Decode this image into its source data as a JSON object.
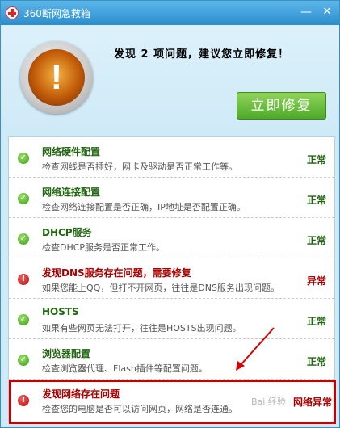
{
  "window": {
    "title": "360断网急救箱",
    "minimize_glyph": "—",
    "close_glyph": "✕",
    "app_icon": "red-cross-icon"
  },
  "header": {
    "warning_icon": "exclamation-icon",
    "warning_glyph": "!",
    "message": "发现 2 项问题，建议您立即修复！",
    "fix_button_label": "立即修复",
    "fix_button_color": "#5cb331"
  },
  "checks": [
    {
      "title": "网络硬件配置",
      "desc": "检查网线是否插好，网卡及驱动是否正常工作等。",
      "status": "正常",
      "ok": true
    },
    {
      "title": "网络连接配置",
      "desc": "检查网络连接配置是否正确，IP地址是否配置正确。",
      "status": "正常",
      "ok": true
    },
    {
      "title": "DHCP服务",
      "desc": "检查DHCP服务是否正常工作。",
      "status": "正常",
      "ok": true
    },
    {
      "title": "发现DNS服务存在问题，需要修复",
      "desc": "如果您能上QQ，但打不开网页，往往是DNS服务出现问题。",
      "status": "异常",
      "ok": false
    },
    {
      "title": "HOSTS",
      "desc": "如果有些网页无法打开，往往是HOSTS出现问题。",
      "status": "正常",
      "ok": true
    },
    {
      "title": "浏览器配置",
      "desc": "检查浏览器代理、Flash插件等配置问题。",
      "status": "正常",
      "ok": true
    },
    {
      "title": "发现网络存在问题",
      "desc": "检查您的电脑是否可以访问网页，网络是否连通。",
      "status": "网络异常",
      "ok": false
    }
  ],
  "glyphs": {
    "ok": "✓",
    "err": "!"
  },
  "colors": {
    "ok": "#3a9c17",
    "error": "#b30f0f",
    "highlight": "#c40000"
  },
  "watermark": "Bai 经验"
}
